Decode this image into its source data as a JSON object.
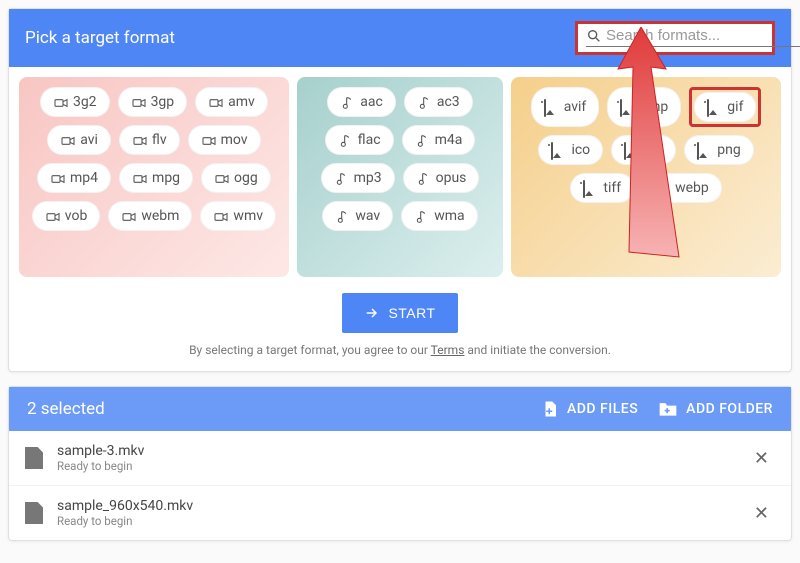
{
  "header": {
    "title": "Pick a target format",
    "search_placeholder": "Search formats..."
  },
  "groups": {
    "video": [
      "3g2",
      "3gp",
      "amv",
      "avi",
      "flv",
      "mov",
      "mp4",
      "mpg",
      "ogg",
      "vob",
      "webm",
      "wmv"
    ],
    "audio": [
      "aac",
      "ac3",
      "flac",
      "m4a",
      "mp3",
      "opus",
      "wav",
      "wma"
    ],
    "image": [
      "avif",
      "bmp",
      "gif",
      "ico",
      "jpg",
      "png",
      "tiff",
      "webp"
    ]
  },
  "highlighted_format": "gif",
  "start_label": "START",
  "terms": {
    "prefix": "By selecting a target format, you agree to our ",
    "link": "Terms",
    "suffix": " and initiate the conversion."
  },
  "selection": {
    "count_label": "2 selected",
    "add_files": "ADD FILES",
    "add_folder": "ADD FOLDER",
    "files": [
      {
        "name": "sample-3.mkv",
        "status": "Ready to begin"
      },
      {
        "name": "sample_960x540.mkv",
        "status": "Ready to begin"
      }
    ]
  }
}
